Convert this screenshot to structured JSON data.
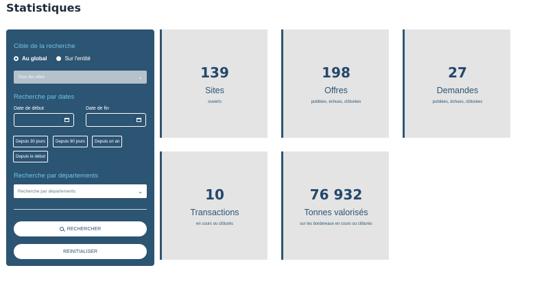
{
  "page": {
    "title": "Statistiques"
  },
  "search_panel": {
    "target_title": "Cible de la recherche",
    "radio_global": "Au global",
    "radio_entity": "Sur l'entité",
    "sites_select": "Tous les sites",
    "dates_title": "Recherche par dates",
    "start_label": "Date de début",
    "end_label": "Date de fin",
    "quick_30": "Depuis 30 jours",
    "quick_90": "Depuis 90 jours",
    "quick_year": "Depuis un an",
    "quick_start": "Depuis le début",
    "dept_title": "Recherche par départements",
    "dept_placeholder": "Recherche par départements",
    "search_button": "RECHERCHER",
    "reset_button": "REINITIALISER"
  },
  "stats": [
    {
      "value": "139",
      "label": "Sites",
      "sub": "ouverts"
    },
    {
      "value": "198",
      "label": "Offres",
      "sub": "publiées, échues, clôturées"
    },
    {
      "value": "27",
      "label": "Demandes",
      "sub": "publiées, échues, clôturées"
    },
    {
      "value": "10",
      "label": "Transactions",
      "sub": "en cours ou clôturés"
    },
    {
      "value": "76 932",
      "label": "Tonnes valorisés",
      "sub": "sur les bordereaux en cours ou clôturés"
    }
  ],
  "colors": {
    "panel": "#2c5473",
    "accent": "#6ec6e3",
    "card_bg": "#e4e4e4"
  }
}
